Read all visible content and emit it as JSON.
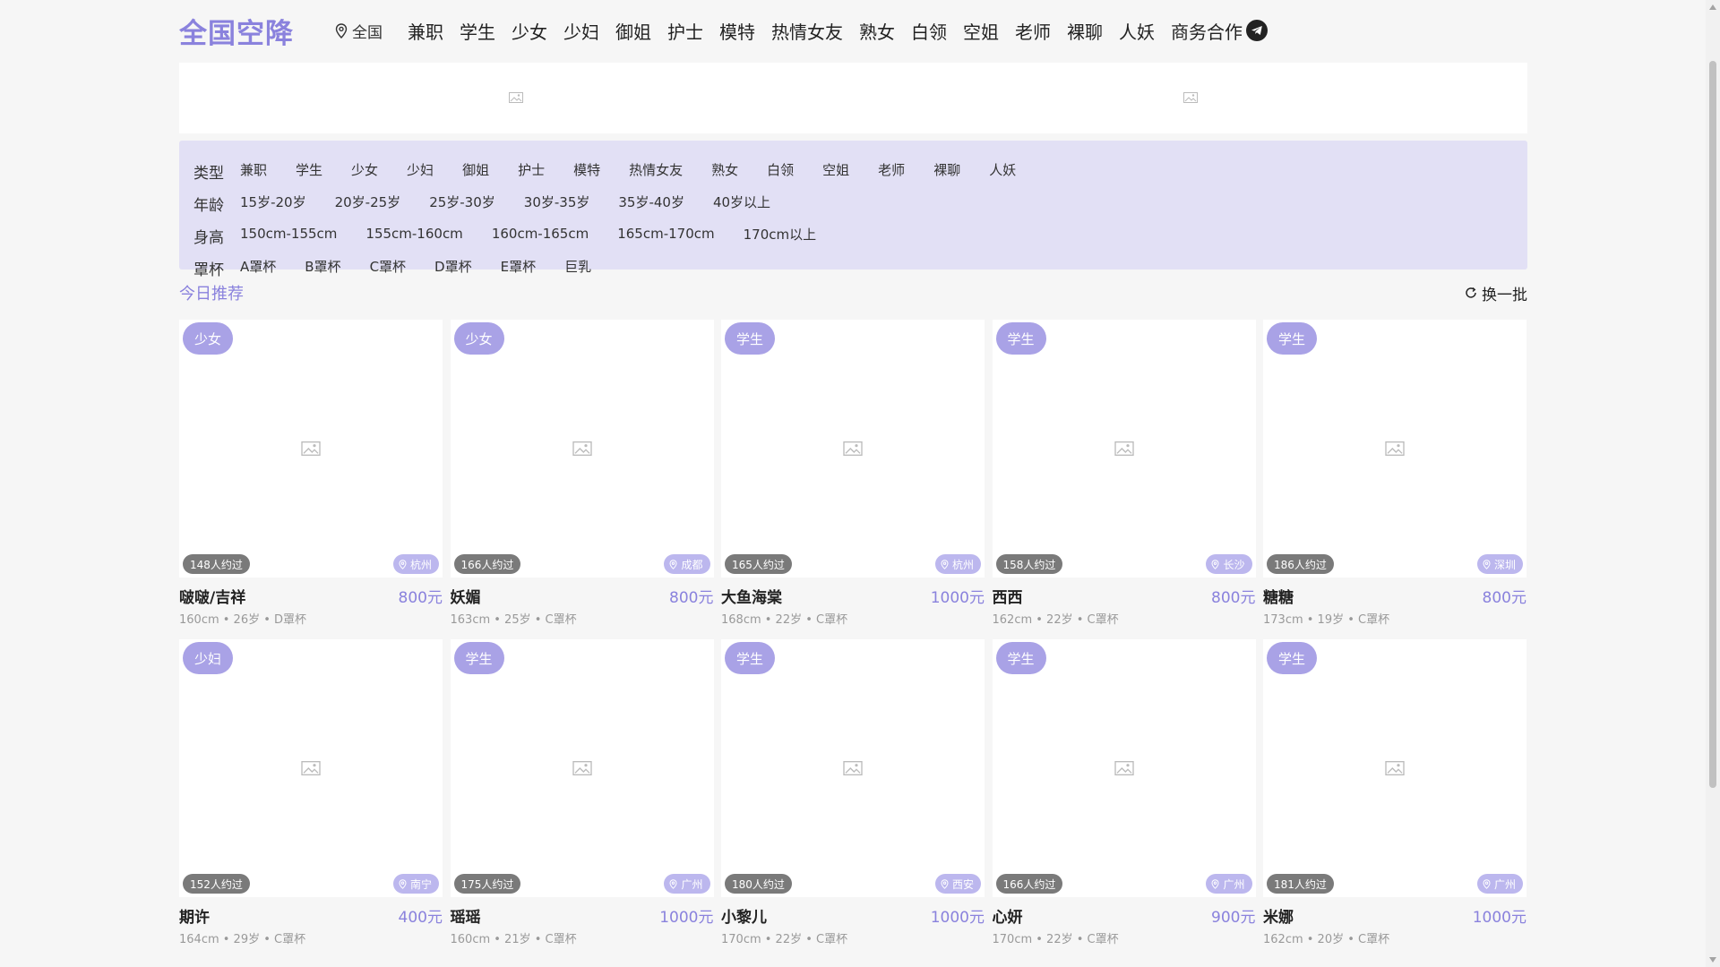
{
  "colors": {
    "accent": "#8a82dd",
    "tag_bg": "#a9a2e6",
    "filter_bg": "#e2e0f5"
  },
  "header": {
    "logo": "全国空降",
    "location": "全国",
    "nav": [
      "兼职",
      "学生",
      "少女",
      "少妇",
      "御姐",
      "护士",
      "模特",
      "热情女友",
      "熟女",
      "白领",
      "空姐",
      "老师",
      "裸聊",
      "人妖"
    ],
    "business": "商务合作",
    "business_icon": "telegram-icon"
  },
  "filters": [
    {
      "label": "类型",
      "options": [
        "兼职",
        "学生",
        "少女",
        "少妇",
        "御姐",
        "护士",
        "模特",
        "热情女友",
        "熟女",
        "白领",
        "空姐",
        "老师",
        "裸聊",
        "人妖"
      ]
    },
    {
      "label": "年龄",
      "options": [
        "15岁-20岁",
        "20岁-25岁",
        "25岁-30岁",
        "30岁-35岁",
        "35岁-40岁",
        "40岁以上"
      ]
    },
    {
      "label": "身高",
      "options": [
        "150cm-155cm",
        "155cm-160cm",
        "160cm-165cm",
        "165cm-170cm",
        "170cm以上"
      ]
    },
    {
      "label": "罩杯",
      "options": [
        "A罩杯",
        "B罩杯",
        "C罩杯",
        "D罩杯",
        "E罩杯",
        "巨乳"
      ]
    }
  ],
  "section": {
    "title": "今日推荐",
    "refresh": "换一批"
  },
  "cards": [
    {
      "tag": "少女",
      "booked": "148人约过",
      "city": "杭州",
      "name": "啵啵/吉祥",
      "price": "800元",
      "meta": "160cm • 26岁 • D罩杯"
    },
    {
      "tag": "少女",
      "booked": "166人约过",
      "city": "成都",
      "name": "妖媚",
      "price": "800元",
      "meta": "163cm • 25岁 • C罩杯"
    },
    {
      "tag": "学生",
      "booked": "165人约过",
      "city": "杭州",
      "name": "大鱼海棠",
      "price": "1000元",
      "meta": "168cm • 22岁 • C罩杯"
    },
    {
      "tag": "学生",
      "booked": "158人约过",
      "city": "长沙",
      "name": "西西",
      "price": "800元",
      "meta": "162cm • 22岁 • C罩杯"
    },
    {
      "tag": "学生",
      "booked": "186人约过",
      "city": "深圳",
      "name": "糖糖",
      "price": "800元",
      "meta": "173cm • 19岁 • C罩杯"
    },
    {
      "tag": "少妇",
      "booked": "152人约过",
      "city": "南宁",
      "name": "期许",
      "price": "400元",
      "meta": "164cm • 29岁 • C罩杯"
    },
    {
      "tag": "学生",
      "booked": "175人约过",
      "city": "广州",
      "name": "瑶瑶",
      "price": "1000元",
      "meta": "160cm • 21岁 • C罩杯"
    },
    {
      "tag": "学生",
      "booked": "180人约过",
      "city": "西安",
      "name": "小黎儿",
      "price": "1000元",
      "meta": "170cm • 22岁 • C罩杯"
    },
    {
      "tag": "学生",
      "booked": "166人约过",
      "city": "广州",
      "name": "心妍",
      "price": "900元",
      "meta": "170cm • 22岁 • C罩杯"
    },
    {
      "tag": "学生",
      "booked": "181人约过",
      "city": "广州",
      "name": "米娜",
      "price": "1000元",
      "meta": "162cm • 20岁 • C罩杯"
    }
  ]
}
